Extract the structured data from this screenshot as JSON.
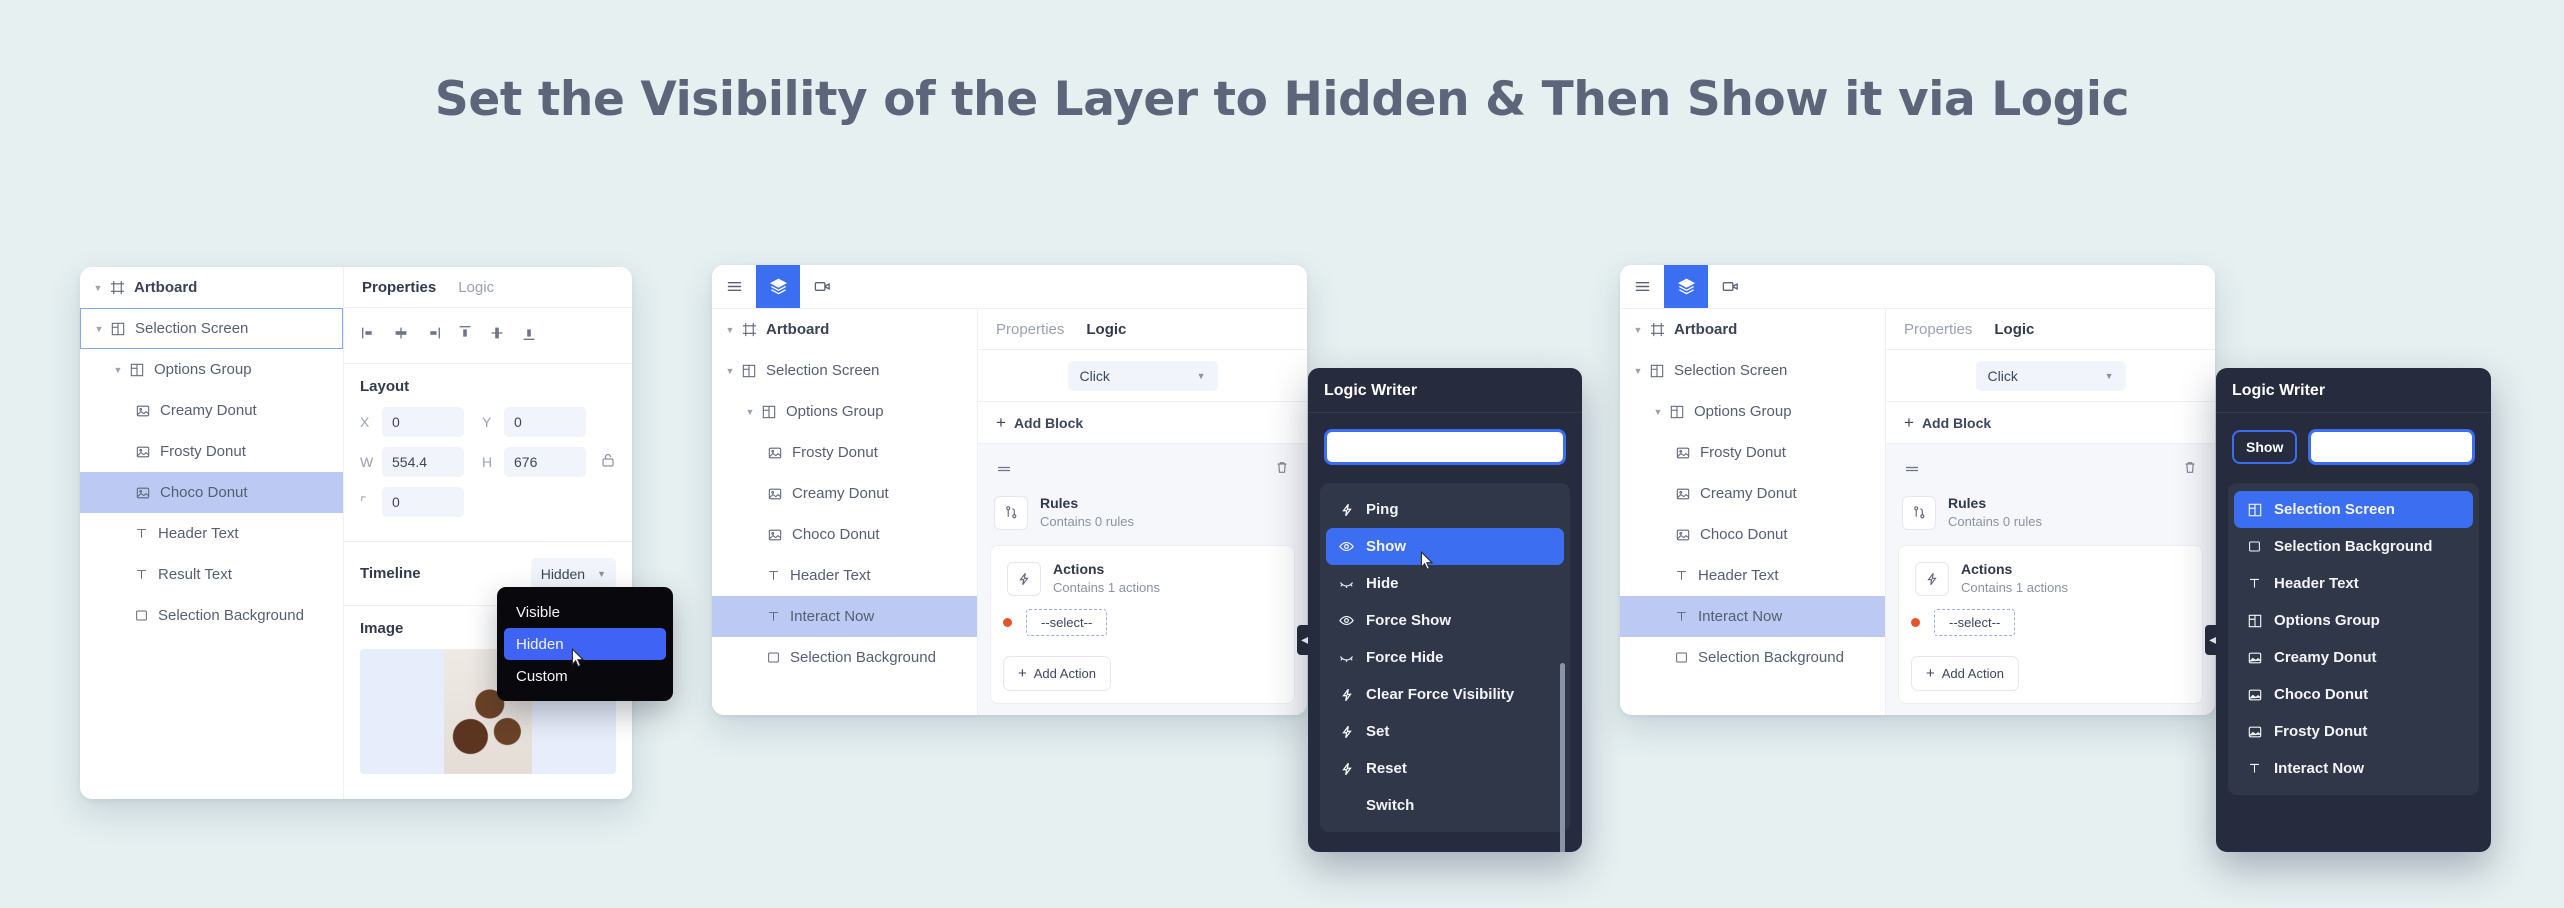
{
  "page": {
    "title": "Set the Visibility of the Layer to Hidden & Then Show it via Logic",
    "background_color": "#e6f0f1",
    "accent_color": "#3b6ef0",
    "selected_row_color": "#bcc9f2"
  },
  "panel1": {
    "tree": [
      {
        "label": "Artboard",
        "icon": "artboard-icon",
        "indent": 1,
        "caret": true,
        "state": "bold"
      },
      {
        "label": "Selection Screen",
        "icon": "frame-icon",
        "indent": 1,
        "caret": true,
        "state": "outlined"
      },
      {
        "label": "Options Group",
        "icon": "frame-icon",
        "indent": 2,
        "caret": true,
        "state": ""
      },
      {
        "label": "Creamy Donut",
        "icon": "image-icon",
        "indent": 3,
        "caret": false,
        "state": ""
      },
      {
        "label": "Frosty Donut",
        "icon": "image-icon",
        "indent": 3,
        "caret": false,
        "state": ""
      },
      {
        "label": "Choco Donut",
        "icon": "image-icon",
        "indent": 3,
        "caret": false,
        "state": "selected"
      },
      {
        "label": "Header Text",
        "icon": "text-icon",
        "indent": 2,
        "caret": false,
        "state": ""
      },
      {
        "label": "Result Text",
        "icon": "text-icon",
        "indent": 2,
        "caret": false,
        "state": ""
      },
      {
        "label": "Selection Background",
        "icon": "rectangle-icon",
        "indent": 2,
        "caret": false,
        "state": ""
      }
    ],
    "tabs": {
      "properties": "Properties",
      "logic": "Logic",
      "active": "Properties"
    },
    "align_icons": [
      "align-left-icon",
      "align-center-horizontal-icon",
      "align-right-icon",
      "align-top-icon",
      "align-center-vertical-icon",
      "align-bottom-icon"
    ],
    "layout": {
      "title": "Layout",
      "fields": [
        {
          "label": "X",
          "value": "0"
        },
        {
          "label": "Y",
          "value": "0"
        },
        {
          "label": "W",
          "value": "554.4"
        },
        {
          "label": "H",
          "value": "676"
        },
        {
          "label": "⌜",
          "value": "0"
        }
      ],
      "lock_icon": "unlock-icon"
    },
    "timeline": {
      "label": "Timeline",
      "value": "Hidden",
      "options": [
        "Visible",
        "Hidden",
        "Custom"
      ],
      "selected_option": "Hidden"
    },
    "image": {
      "label": "Image",
      "thumb": "donut-photo"
    }
  },
  "panel2": {
    "toolbar": [
      {
        "icon": "menu-icon",
        "active": false
      },
      {
        "icon": "layers-icon",
        "active": true
      },
      {
        "icon": "video-icon",
        "active": false
      }
    ],
    "tree": [
      {
        "label": "Artboard",
        "icon": "artboard-icon",
        "indent": 1,
        "caret": true,
        "state": "bold"
      },
      {
        "label": "Selection Screen",
        "icon": "frame-icon",
        "indent": 1,
        "caret": true,
        "state": ""
      },
      {
        "label": "Options Group",
        "icon": "frame-icon",
        "indent": 2,
        "caret": true,
        "state": ""
      },
      {
        "label": "Frosty Donut",
        "icon": "image-icon",
        "indent": 3,
        "caret": false,
        "state": ""
      },
      {
        "label": "Creamy Donut",
        "icon": "image-icon",
        "indent": 3,
        "caret": false,
        "state": ""
      },
      {
        "label": "Choco Donut",
        "icon": "image-icon",
        "indent": 3,
        "caret": false,
        "state": ""
      },
      {
        "label": "Header Text",
        "icon": "text-icon",
        "indent": 2,
        "caret": false,
        "state": ""
      },
      {
        "label": "Interact Now",
        "icon": "text-icon",
        "indent": 2,
        "caret": false,
        "state": "selected"
      },
      {
        "label": "Selection Background",
        "icon": "rectangle-icon",
        "indent": 2,
        "caret": false,
        "state": ""
      }
    ],
    "tabs": {
      "properties": "Properties",
      "logic": "Logic",
      "active": "Logic"
    },
    "trigger": {
      "value": "Click"
    },
    "add_block": "Add Block",
    "rules": {
      "title": "Rules",
      "subtitle": "Contains 0 rules",
      "icon": "rules-icon"
    },
    "actions": {
      "title": "Actions",
      "subtitle": "Contains 1 actions",
      "icon": "bolt-icon",
      "select_placeholder": "--select--",
      "add_action": "Add Action"
    },
    "delete_icon": "trash-icon",
    "drag_icon": "drag-handle-icon"
  },
  "logic_writer_1": {
    "title": "Logic Writer",
    "input_value": "",
    "items": [
      {
        "label": "Ping",
        "icon": "bolt-icon",
        "active": false
      },
      {
        "label": "Show",
        "icon": "eye-icon",
        "active": true
      },
      {
        "label": "Hide",
        "icon": "eye-off-icon",
        "active": false
      },
      {
        "label": "Force Show",
        "icon": "eye-icon",
        "active": false
      },
      {
        "label": "Force Hide",
        "icon": "eye-off-icon",
        "active": false
      },
      {
        "label": "Clear Force Visibility",
        "icon": "bolt-icon",
        "active": false
      },
      {
        "label": "Set",
        "icon": "bolt-icon",
        "active": false
      },
      {
        "label": "Reset",
        "icon": "bolt-icon",
        "active": false
      },
      {
        "label": "Switch",
        "icon": "",
        "active": false
      }
    ]
  },
  "panel3": {
    "toolbar": [
      {
        "icon": "menu-icon",
        "active": false
      },
      {
        "icon": "layers-icon",
        "active": true
      },
      {
        "icon": "video-icon",
        "active": false
      }
    ],
    "tree": [
      {
        "label": "Artboard",
        "icon": "artboard-icon",
        "indent": 1,
        "caret": true,
        "state": "bold"
      },
      {
        "label": "Selection Screen",
        "icon": "frame-icon",
        "indent": 1,
        "caret": true,
        "state": ""
      },
      {
        "label": "Options Group",
        "icon": "frame-icon",
        "indent": 2,
        "caret": true,
        "state": ""
      },
      {
        "label": "Frosty Donut",
        "icon": "image-icon",
        "indent": 3,
        "caret": false,
        "state": ""
      },
      {
        "label": "Creamy Donut",
        "icon": "image-icon",
        "indent": 3,
        "caret": false,
        "state": ""
      },
      {
        "label": "Choco Donut",
        "icon": "image-icon",
        "indent": 3,
        "caret": false,
        "state": ""
      },
      {
        "label": "Header Text",
        "icon": "text-icon",
        "indent": 2,
        "caret": false,
        "state": ""
      },
      {
        "label": "Interact Now",
        "icon": "text-icon",
        "indent": 2,
        "caret": false,
        "state": "selected"
      },
      {
        "label": "Selection Background",
        "icon": "rectangle-icon",
        "indent": 2,
        "caret": false,
        "state": ""
      }
    ],
    "tabs": {
      "properties": "Properties",
      "logic": "Logic",
      "active": "Logic"
    },
    "trigger": {
      "value": "Click"
    },
    "add_block": "Add Block",
    "rules": {
      "title": "Rules",
      "subtitle": "Contains 0 rules",
      "icon": "rules-icon"
    },
    "actions": {
      "title": "Actions",
      "subtitle": "Contains 1 actions",
      "icon": "bolt-icon",
      "select_placeholder": "--select--",
      "add_action": "Add Action"
    },
    "delete_icon": "trash-icon",
    "drag_icon": "drag-handle-icon"
  },
  "logic_writer_2": {
    "title": "Logic Writer",
    "chip_label": "Show",
    "input_value": "",
    "items": [
      {
        "label": "Selection Screen",
        "icon": "frame-icon",
        "active": true
      },
      {
        "label": "Selection Background",
        "icon": "rectangle-icon",
        "active": false
      },
      {
        "label": "Header Text",
        "icon": "text-icon",
        "active": false
      },
      {
        "label": "Options Group",
        "icon": "frame-icon",
        "active": false
      },
      {
        "label": "Creamy Donut",
        "icon": "image-icon",
        "active": false
      },
      {
        "label": "Choco Donut",
        "icon": "image-icon",
        "active": false
      },
      {
        "label": "Frosty Donut",
        "icon": "image-icon",
        "active": false
      },
      {
        "label": "Interact Now",
        "icon": "text-icon",
        "active": false
      }
    ]
  }
}
